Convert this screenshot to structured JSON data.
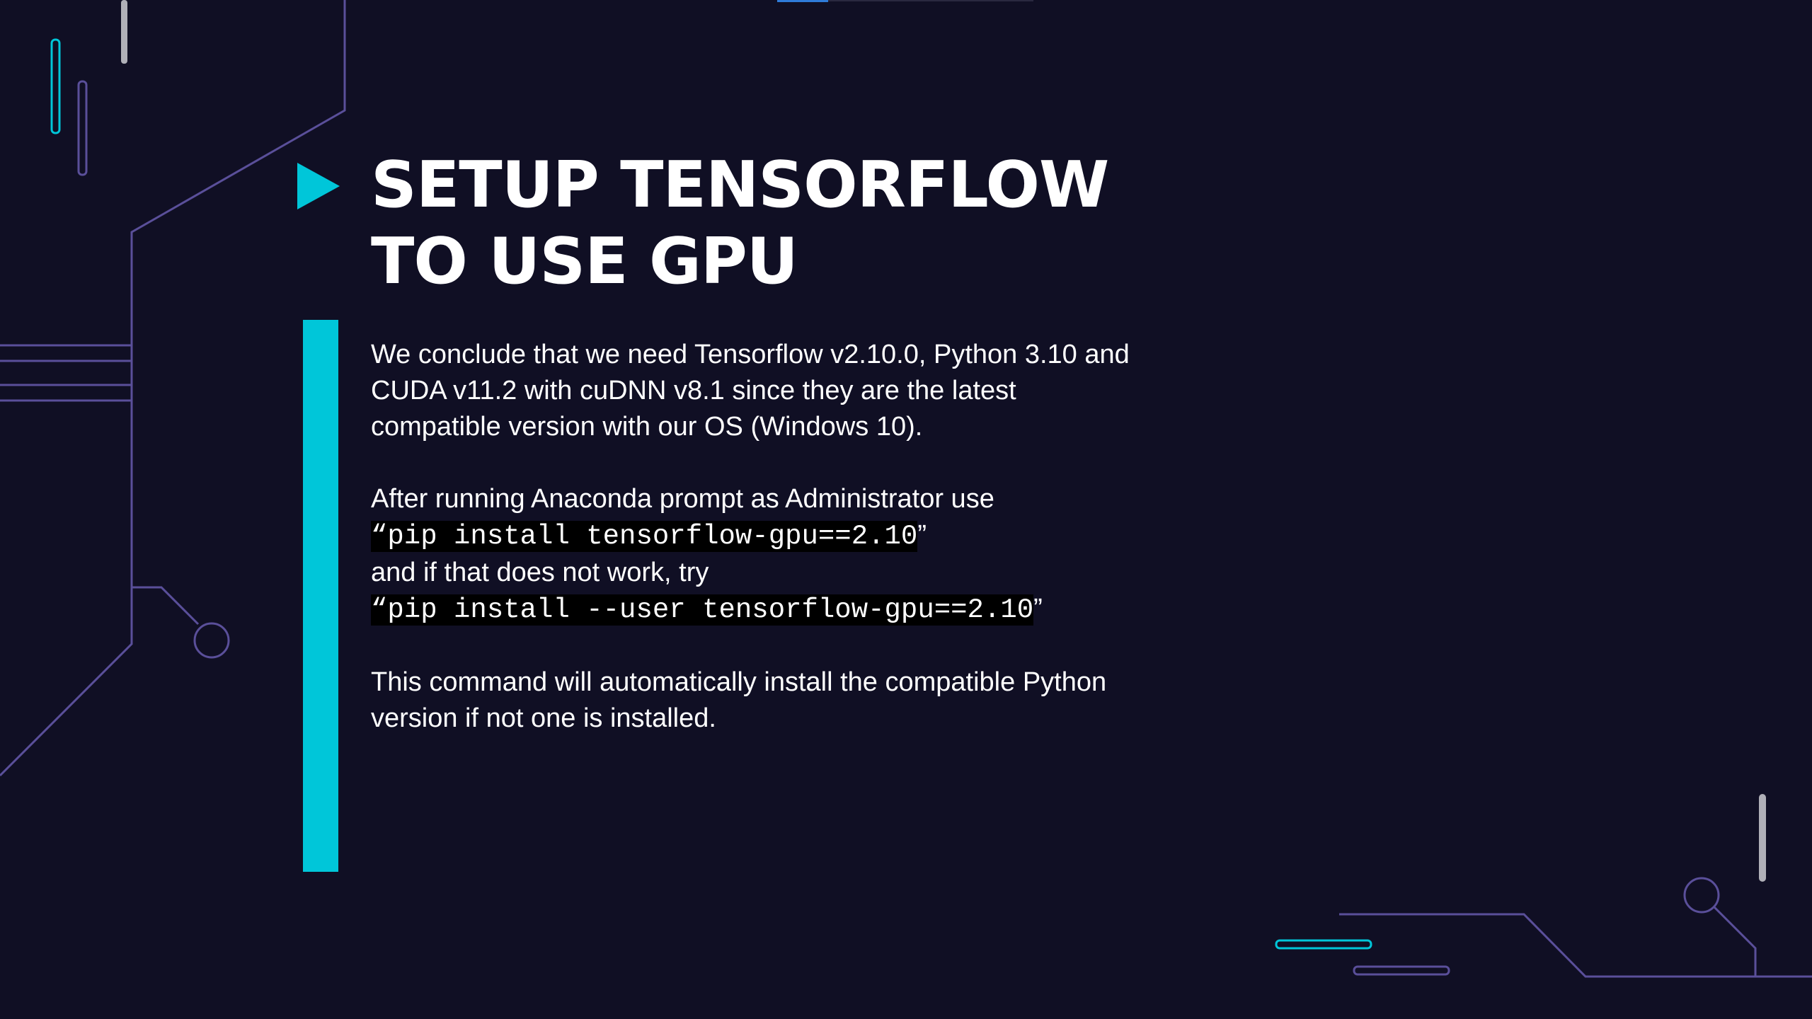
{
  "title": {
    "line1": "SETUP TENSORFLOW",
    "line2": "TO USE GPU"
  },
  "paragraph1": {
    "line1": "We conclude that we need Tensorflow v2.10.0, Python 3.10 and",
    "line2": "CUDA v11.2 with cuDNN v8.1 since they are the latest",
    "line3": "compatible version with our OS (Windows 10)."
  },
  "paragraph2": {
    "intro": "After running Anaconda prompt as Administrator use",
    "open_quote": "“",
    "close_quote": "”",
    "command1": "pip install tensorflow-gpu==2.10",
    "fallback": "and if that does not work, try",
    "command2": "pip install --user tensorflow-gpu==2.10"
  },
  "paragraph3": {
    "line1": "This command will automatically install the compatible Python",
    "line2": "version if not one is installed."
  },
  "icons": {
    "bullet": "play-triangle-icon"
  },
  "colors": {
    "background": "#100f24",
    "accent": "#00c6d9",
    "circuit_line": "#5a4f9a",
    "text": "#ffffff",
    "code_background": "#000000"
  }
}
